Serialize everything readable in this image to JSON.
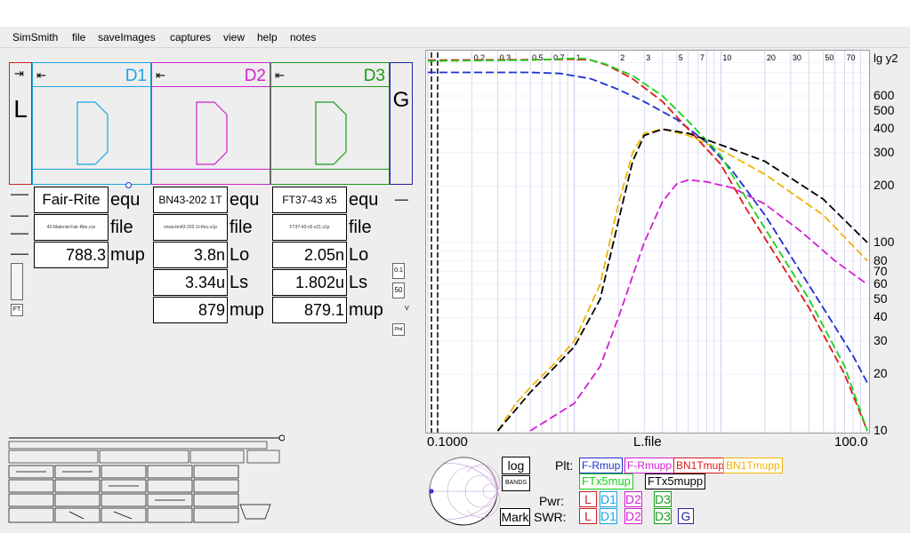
{
  "menu": [
    "SimSmith",
    "file",
    "saveImages",
    "captures",
    "view",
    "help",
    "notes"
  ],
  "colors": {
    "d1": "#1aa5e0",
    "d2": "#d21fd2",
    "d3": "#1a9a1a",
    "load": "#cc2222",
    "gen": "#2222aa",
    "rmup": "#1a30d0",
    "rmupp": "#d21fd2",
    "bn_mup": "#e01818",
    "bn_mupp": "#f0b400",
    "ft_mup": "#18d018",
    "ft_mupp": "#000000",
    "grid": "#c8c8f0"
  },
  "components": {
    "load_label": "L",
    "gen_label": "G",
    "d1_label": "D1",
    "d2_label": "D2",
    "d3_label": "D3",
    "arrow_in": "⇥",
    "arrow_left": "⇤"
  },
  "params": {
    "d1": {
      "name": "Fair-Rite",
      "file": "43-Material-Fair-Rite.csv",
      "mup": "788.3",
      "unit_equ": "equ",
      "unit_file": "file",
      "unit_mup": "mup"
    },
    "d2": {
      "name": "BN43-202 1T",
      "file": "vnwa-bn43-202-1t-thru.s1p",
      "lo": "3.8n",
      "ls": "3.34u",
      "mup": "879",
      "unit_equ": "equ",
      "unit_file": "file",
      "unit_lo": "Lo",
      "unit_ls": "Ls",
      "unit_mup": "mup"
    },
    "d3": {
      "name": "FT37-43 x5",
      "file": "FT37-43-x5-s21.s1p",
      "lo": "2.05n",
      "ls": "1.802u",
      "mup": "879.1",
      "unit_equ": "equ",
      "unit_file": "file",
      "unit_lo": "Lo",
      "unit_ls": "Ls",
      "unit_mup": "mup"
    }
  },
  "gen_side": {
    "v1": "0.1",
    "v2": "50",
    "v3": "V",
    "v4": "Phd"
  },
  "left_side": {
    "ft": "FT"
  },
  "chart_data": {
    "type": "line",
    "title": "",
    "xlabel": "L.file",
    "ylabel": "lg y2",
    "x_scale": "log",
    "y_scale": "log",
    "xlim": [
      0.1,
      100
    ],
    "ylim": [
      10,
      1000
    ],
    "x_axis_labels": [
      "0.1000",
      "100.0"
    ],
    "top_ticks": [
      "0.2",
      "0.3",
      "0.5",
      "0.7",
      "1",
      "2",
      "3",
      "5",
      "7",
      "10",
      "20",
      "30",
      "50",
      "70"
    ],
    "right_ticks": [
      "600",
      "500",
      "400",
      "300",
      "200",
      "100",
      "80",
      "70",
      "60",
      "50",
      "40",
      "30",
      "20",
      "10"
    ],
    "series": [
      {
        "name": "F-Rmup",
        "x": [
          0.1,
          0.5,
          0.8,
          1.3,
          2,
          3,
          5,
          8,
          12,
          20,
          35,
          55,
          80,
          100
        ],
        "y": [
          800,
          800,
          790,
          740,
          650,
          560,
          450,
          340,
          240,
          140,
          70,
          40,
          25,
          18
        ]
      },
      {
        "name": "F-Rmupp",
        "x": [
          0.5,
          1,
          1.5,
          2,
          3,
          4,
          5,
          6,
          8,
          12,
          20,
          35,
          60,
          100
        ],
        "y": [
          10,
          14,
          22,
          40,
          100,
          165,
          205,
          215,
          210,
          195,
          160,
          115,
          80,
          60
        ]
      },
      {
        "name": "BN1Tmup",
        "x": [
          0.1,
          0.5,
          1,
          1.3,
          1.7,
          2.5,
          4,
          6,
          10,
          15,
          25,
          40,
          70,
          100
        ],
        "y": [
          930,
          935,
          940,
          930,
          870,
          740,
          560,
          400,
          260,
          150,
          80,
          45,
          20,
          10
        ]
      },
      {
        "name": "BN1Tmupp",
        "x": [
          0.3,
          0.4,
          0.5,
          0.7,
          1,
          1.5,
          2,
          2.5,
          3,
          4,
          6,
          10,
          20,
          50,
          100
        ],
        "y": [
          10,
          14,
          17,
          22,
          30,
          60,
          160,
          300,
          380,
          400,
          370,
          310,
          230,
          140,
          80
        ]
      },
      {
        "name": "FTx5mup",
        "x": [
          0.1,
          0.5,
          1,
          1.2,
          1.6,
          2.5,
          4,
          6,
          10,
          15,
          25,
          40,
          70,
          100
        ],
        "y": [
          920,
          930,
          950,
          945,
          890,
          770,
          600,
          440,
          290,
          170,
          90,
          50,
          22,
          10
        ]
      },
      {
        "name": "FTx5mupp",
        "x": [
          0.3,
          0.4,
          0.5,
          0.7,
          1,
          1.5,
          2,
          2.5,
          3,
          4,
          6,
          10,
          20,
          50,
          100
        ],
        "y": [
          10,
          13,
          16,
          21,
          28,
          50,
          130,
          270,
          370,
          400,
          380,
          330,
          270,
          170,
          100
        ]
      }
    ]
  },
  "plot": {
    "log_btn": "log",
    "bands_btn": "BANDS",
    "mark_btn": "Mark",
    "plt_label": "Plt:",
    "pwr_label": "Pwr:",
    "swr_label": "SWR:",
    "legend": [
      "F-Rmup",
      "F-Rmupp",
      "BN1Tmup",
      "BN1Tmupp",
      "FTx5mup",
      "FTx5mupp"
    ],
    "pwr_items": [
      "L",
      "D1",
      "D2",
      "D3"
    ],
    "swr_items": [
      "L",
      "D1",
      "D2",
      "D3",
      "G"
    ]
  }
}
